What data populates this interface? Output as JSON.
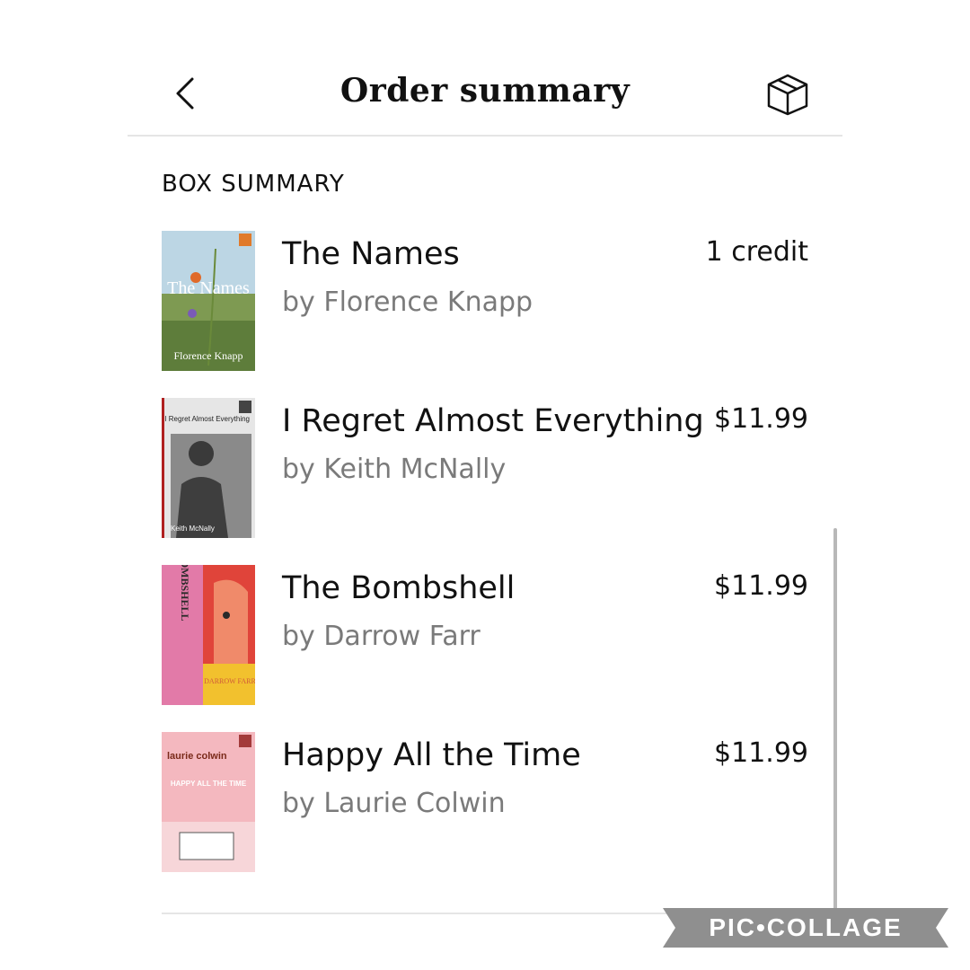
{
  "header": {
    "title": "Order summary",
    "back_icon": "chevron-left-icon",
    "box_icon": "box-icon"
  },
  "section_label": "BOX SUMMARY",
  "items": [
    {
      "title": "The Names",
      "author": "by Florence Knapp",
      "price": "1 credit",
      "cover": {
        "title": "The Names",
        "author": "Florence Knapp"
      }
    },
    {
      "title": "I Regret Almost Everything",
      "author": "by Keith McNally",
      "price": "$11.99",
      "cover": {
        "title": "I Regret Almost Everything",
        "author": "Keith McNally"
      }
    },
    {
      "title": "The Bombshell",
      "author": "by Darrow Farr",
      "price": "$11.99",
      "cover": {
        "title": "THE BOMBSHELL",
        "author": "DARROW FARR"
      }
    },
    {
      "title": "Happy All the Time",
      "author": "by Laurie Colwin",
      "price": "$11.99",
      "cover": {
        "title": "HAPPY ALL THE TIME",
        "author": "laurie colwin"
      }
    }
  ],
  "watermark": "PIC•COLLAGE",
  "colors": {
    "secondary_text": "#7a7a7a",
    "divider": "#e5e5e5",
    "scrollbar": "#b8b8b8"
  }
}
